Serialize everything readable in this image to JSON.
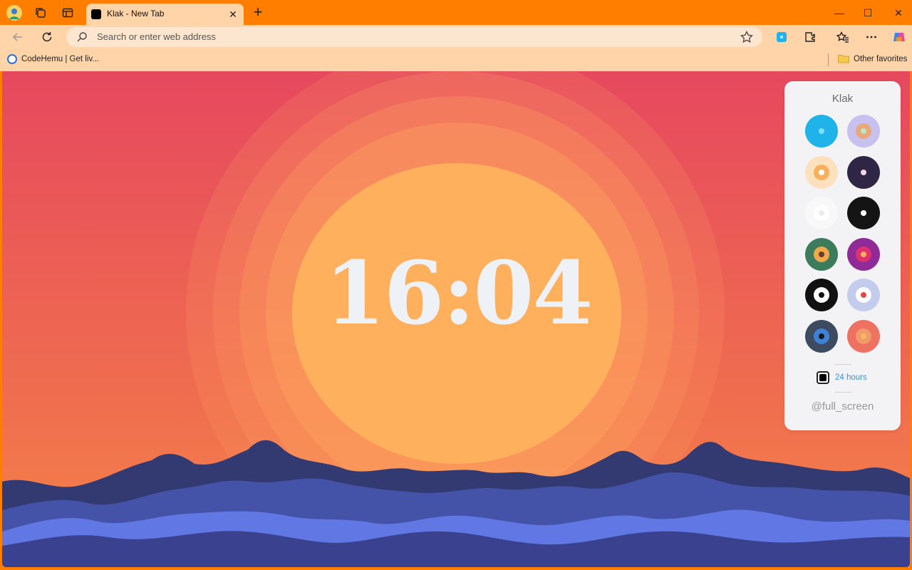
{
  "browser": {
    "tab": {
      "title": "Klak - New Tab",
      "close": "✕"
    },
    "new_tab": "+",
    "window": {
      "minimize": "—",
      "maximize": "☐",
      "close": "✕"
    },
    "address": {
      "placeholder": "Search or enter web address"
    },
    "bookmarks": [
      {
        "label": "CodeHemu | Get liv..."
      }
    ],
    "other_favorites": "Other favorites"
  },
  "clock": {
    "time": "16:04"
  },
  "panel": {
    "title": "Klak",
    "themes": [
      {
        "outer": "#1fb3ea",
        "mid": "#1fb3ea",
        "dot": "#7fe0f5"
      },
      {
        "outer": "#c8c0ee",
        "mid": "#e9a87a",
        "dot": "#bde3c8"
      },
      {
        "outer": "#fde0bd",
        "mid": "#f8b05a",
        "dot": "#ffffff"
      },
      {
        "outer": "#2f2645",
        "mid": "#2f2645",
        "dot": "#f4d4e4"
      },
      {
        "outer": "#f8f8f8",
        "mid": "#ffffff",
        "dot": "#ececec"
      },
      {
        "outer": "#141414",
        "mid": "#141414",
        "dot": "#ffffff"
      },
      {
        "outer": "#3c7c5c",
        "mid": "#f0a94a",
        "dot": "#6b3c2a"
      },
      {
        "outer": "#8f2a96",
        "mid": "#e0306e",
        "dot": "#f7b35c"
      },
      {
        "outer": "#111111",
        "mid": "#ffffff",
        "dot": "#111111"
      },
      {
        "outer": "#c4ccee",
        "mid": "#ffffff",
        "dot": "#e0464a"
      },
      {
        "outer": "#3c4b5f",
        "mid": "#3d82d6",
        "dot": "#1a1a1a"
      },
      {
        "outer": "#ee7262",
        "mid": "#f39a6a",
        "dot": "#f9b56a"
      }
    ],
    "format_label": "24 hours",
    "format_checked": true,
    "fullscreen_label": "@full_screen"
  }
}
